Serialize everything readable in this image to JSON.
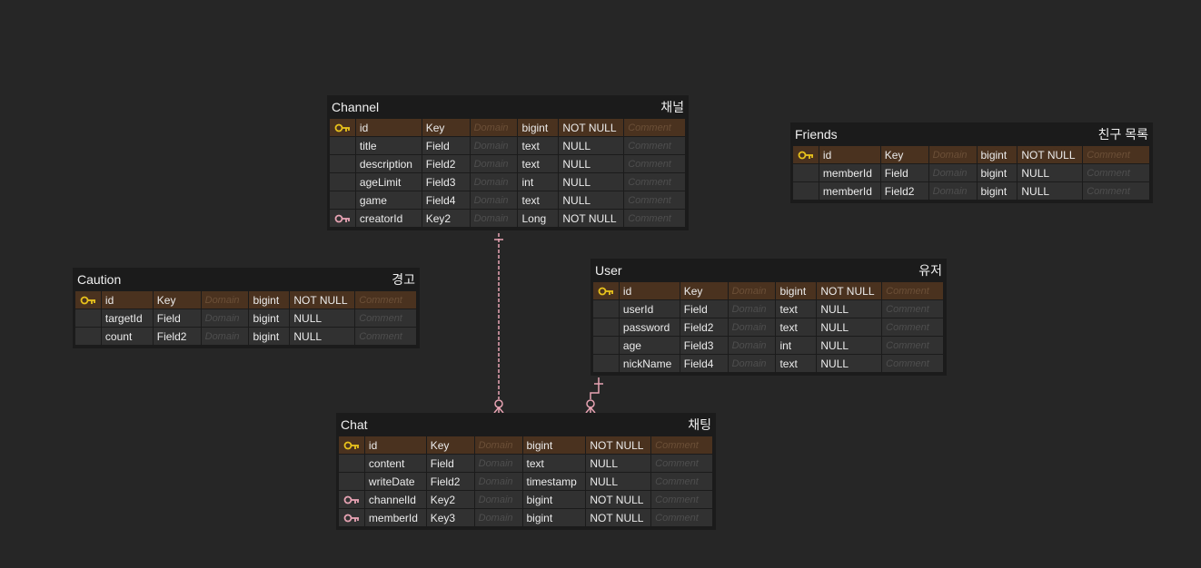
{
  "colors": {
    "background": "#262626",
    "table_bg": "#1b1b1b",
    "cell_bg": "#313131",
    "pk_row_bg": "#4a321f",
    "primary_key_icon": "#e8c21c",
    "foreign_key_icon": "#e7a3b3",
    "relation_line": "#e7a3b3"
  },
  "tables": [
    {
      "id": "channel",
      "name": "Channel",
      "comment": "채널",
      "columns": [
        {
          "icon": "primary-key-icon",
          "name": "id",
          "key": "Key",
          "domain": "Domain",
          "type": "bigint",
          "nullable": "NOT NULL",
          "comment": "Comment"
        },
        {
          "icon": "",
          "name": "title",
          "key": "Field",
          "domain": "Domain",
          "type": "text",
          "nullable": "NULL",
          "comment": "Comment"
        },
        {
          "icon": "",
          "name": "description",
          "key": "Field2",
          "domain": "Domain",
          "type": "text",
          "nullable": "NULL",
          "comment": "Comment"
        },
        {
          "icon": "",
          "name": "ageLimit",
          "key": "Field3",
          "domain": "Domain",
          "type": "int",
          "nullable": "NULL",
          "comment": "Comment"
        },
        {
          "icon": "",
          "name": "game",
          "key": "Field4",
          "domain": "Domain",
          "type": "text",
          "nullable": "NULL",
          "comment": "Comment"
        },
        {
          "icon": "foreign-key-icon",
          "name": "creatorId",
          "key": "Key2",
          "domain": "Domain",
          "type": "Long",
          "nullable": "NOT NULL",
          "comment": "Comment"
        }
      ]
    },
    {
      "id": "friends",
      "name": "Friends",
      "comment": "친구 목록",
      "columns": [
        {
          "icon": "primary-key-icon",
          "name": "id",
          "key": "Key",
          "domain": "Domain",
          "type": "bigint",
          "nullable": "NOT NULL",
          "comment": "Comment"
        },
        {
          "icon": "",
          "name": "memberId",
          "key": "Field",
          "domain": "Domain",
          "type": "bigint",
          "nullable": "NULL",
          "comment": "Comment"
        },
        {
          "icon": "",
          "name": "memberId",
          "key": "Field2",
          "domain": "Domain",
          "type": "bigint",
          "nullable": "NULL",
          "comment": "Comment"
        }
      ]
    },
    {
      "id": "caution",
      "name": "Caution",
      "comment": "경고",
      "columns": [
        {
          "icon": "primary-key-icon",
          "name": "id",
          "key": "Key",
          "domain": "Domain",
          "type": "bigint",
          "nullable": "NOT NULL",
          "comment": "Comment"
        },
        {
          "icon": "",
          "name": "targetId",
          "key": "Field",
          "domain": "Domain",
          "type": "bigint",
          "nullable": "NULL",
          "comment": "Comment"
        },
        {
          "icon": "",
          "name": "count",
          "key": "Field2",
          "domain": "Domain",
          "type": "bigint",
          "nullable": "NULL",
          "comment": "Comment"
        }
      ]
    },
    {
      "id": "user",
      "name": "User",
      "comment": "유저",
      "columns": [
        {
          "icon": "primary-key-icon",
          "name": "id",
          "key": "Key",
          "domain": "Domain",
          "type": "bigint",
          "nullable": "NOT NULL",
          "comment": "Comment"
        },
        {
          "icon": "",
          "name": "userId",
          "key": "Field",
          "domain": "Domain",
          "type": "text",
          "nullable": "NULL",
          "comment": "Comment"
        },
        {
          "icon": "",
          "name": "password",
          "key": "Field2",
          "domain": "Domain",
          "type": "text",
          "nullable": "NULL",
          "comment": "Comment"
        },
        {
          "icon": "",
          "name": "age",
          "key": "Field3",
          "domain": "Domain",
          "type": "int",
          "nullable": "NULL",
          "comment": "Comment"
        },
        {
          "icon": "",
          "name": "nickName",
          "key": "Field4",
          "domain": "Domain",
          "type": "text",
          "nullable": "NULL",
          "comment": "Comment"
        }
      ]
    },
    {
      "id": "chat",
      "name": "Chat",
      "comment": "채팅",
      "columns": [
        {
          "icon": "primary-key-icon",
          "name": "id",
          "key": "Key",
          "domain": "Domain",
          "type": "bigint",
          "nullable": "NOT NULL",
          "comment": "Comment"
        },
        {
          "icon": "",
          "name": "content",
          "key": "Field",
          "domain": "Domain",
          "type": "text",
          "nullable": "NULL",
          "comment": "Comment"
        },
        {
          "icon": "",
          "name": "writeDate",
          "key": "Field2",
          "domain": "Domain",
          "type": "timestamp",
          "nullable": "NULL",
          "comment": "Comment"
        },
        {
          "icon": "foreign-key-icon",
          "name": "channelId",
          "key": "Key2",
          "domain": "Domain",
          "type": "bigint",
          "nullable": "NOT NULL",
          "comment": "Comment"
        },
        {
          "icon": "foreign-key-icon",
          "name": "memberId",
          "key": "Key3",
          "domain": "Domain",
          "type": "bigint",
          "nullable": "NOT NULL",
          "comment": "Comment"
        }
      ]
    }
  ],
  "relations": [
    {
      "from": "channel",
      "to": "chat",
      "from_cardinality": "one",
      "to_cardinality": "zero-or-many",
      "style": "dashed"
    },
    {
      "from": "user",
      "to": "chat",
      "from_cardinality": "one",
      "to_cardinality": "zero-or-many",
      "style": "solid"
    }
  ]
}
